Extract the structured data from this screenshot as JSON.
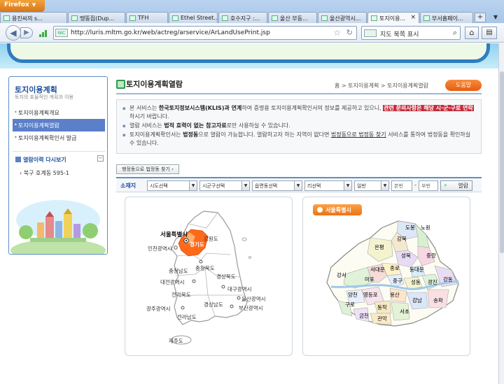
{
  "browser": {
    "app_name": "Firefox",
    "tabs": [
      {
        "label": "용진씨의 s..."
      },
      {
        "label": "땡뚱집(Dup..."
      },
      {
        "label": "TFH"
      },
      {
        "label": "Ethel Street..."
      },
      {
        "label": "호수지구 :..."
      },
      {
        "label": "울산 부동..."
      },
      {
        "label": "울산광역시..."
      },
      {
        "label": "토지이용..."
      },
      {
        "label": "부서홈페이..."
      }
    ],
    "active_tab_index": 7,
    "url": "http://luris.mltm.go.kr/web/actreg/arservice/ArLandUsePrint.jsp",
    "search_text": "지도 북쪽 표시"
  },
  "sidebar": {
    "title": "토지이용계획",
    "subtitle": "토지의 효율적인 계획과 이용",
    "menu": [
      {
        "label": "토지이용계획개요"
      },
      {
        "label": "토지이용계획열람"
      },
      {
        "label": "토지이용계획확인서 발급"
      }
    ],
    "active_index": 1,
    "history_title": "열람이력 다시보기",
    "history_items": [
      "북구 호계동 595-1"
    ]
  },
  "main": {
    "page_title": "토지이용계획열람",
    "breadcrumb": "홈 > 토지이용계획 > 토지이용계획열람",
    "help_label": "도움말",
    "notices": {
      "n1_a": "본 서비스는 ",
      "n1_b": "한국토지정보시스템(KLIS)과 연계",
      "n1_c": "하여 증명용 토지이용계획확인서의 정보를 제공하고 있으니, ",
      "n1_d": "관련 문의사항은 해당 시·군·구로 연락",
      "n1_e": "하시기 바랍니다.",
      "n2_a": "열람 서비스는 ",
      "n2_b": "법적 효력이 없는 참고자료",
      "n2_c": "로만 사용하실 수 있습니다.",
      "n3_a": "토지이용계획확인서는 ",
      "n3_b": "법정동",
      "n3_c": "으로 열람이 가능합니다. 열람하고자 하는 지역이 없다면 ",
      "n3_d": "법정동으로 법정동 찾기",
      "n3_e": " 서비스를 통하여 법정동을 확인하실 수 있습니다."
    },
    "find_button": "행정동으로 법정동 찾기",
    "search": {
      "label": "소재지",
      "sido": "시도선택",
      "sigungu": "시군구선택",
      "emd": "읍면동선택",
      "ri": "리선택",
      "type": "일반",
      "bonbeon": "본번",
      "bubeon": "부번",
      "dash": "-",
      "view_button": "열람"
    },
    "korea_map": {
      "labels": {
        "seoul": "서울특별시",
        "incheon": "인천광역시",
        "gyeonggi": "경기도",
        "gangwon": "강원도",
        "chungnam": "충청남도",
        "chungbuk": "충청북도",
        "daejeon": "대전광역시",
        "gyeongbuk": "경상북도",
        "daegu": "대구광역시",
        "jeonbuk": "전라북도",
        "ulsan": "울산광역시",
        "gyeongnam": "경상남도",
        "busan": "부산광역시",
        "gwangju": "광주광역시",
        "jeonnam": "전라남도",
        "jeju": "제주도"
      }
    },
    "seoul_map": {
      "tag": "서울특별시",
      "districts": {
        "dobong": "도봉",
        "nowon": "노원",
        "gangbuk": "강북",
        "eunpyeong": "은평",
        "seongbuk": "성북",
        "jungnang": "중랑",
        "jongno": "종로",
        "dongdaemun": "동대문",
        "seodaemun": "서대문",
        "jung": "중구",
        "mapo": "마포",
        "gangseo": "강서",
        "seongdong": "성동",
        "gwangjin": "광진",
        "gangdong": "강동",
        "yongsan": "용산",
        "yangcheon": "양천",
        "yeongdeungpo": "영등포",
        "dongjak": "동작",
        "guro": "구로",
        "gangnam": "강남",
        "songpa": "송파",
        "seocho": "서초",
        "geumcheon": "금천",
        "gwanak": "관악"
      }
    }
  }
}
